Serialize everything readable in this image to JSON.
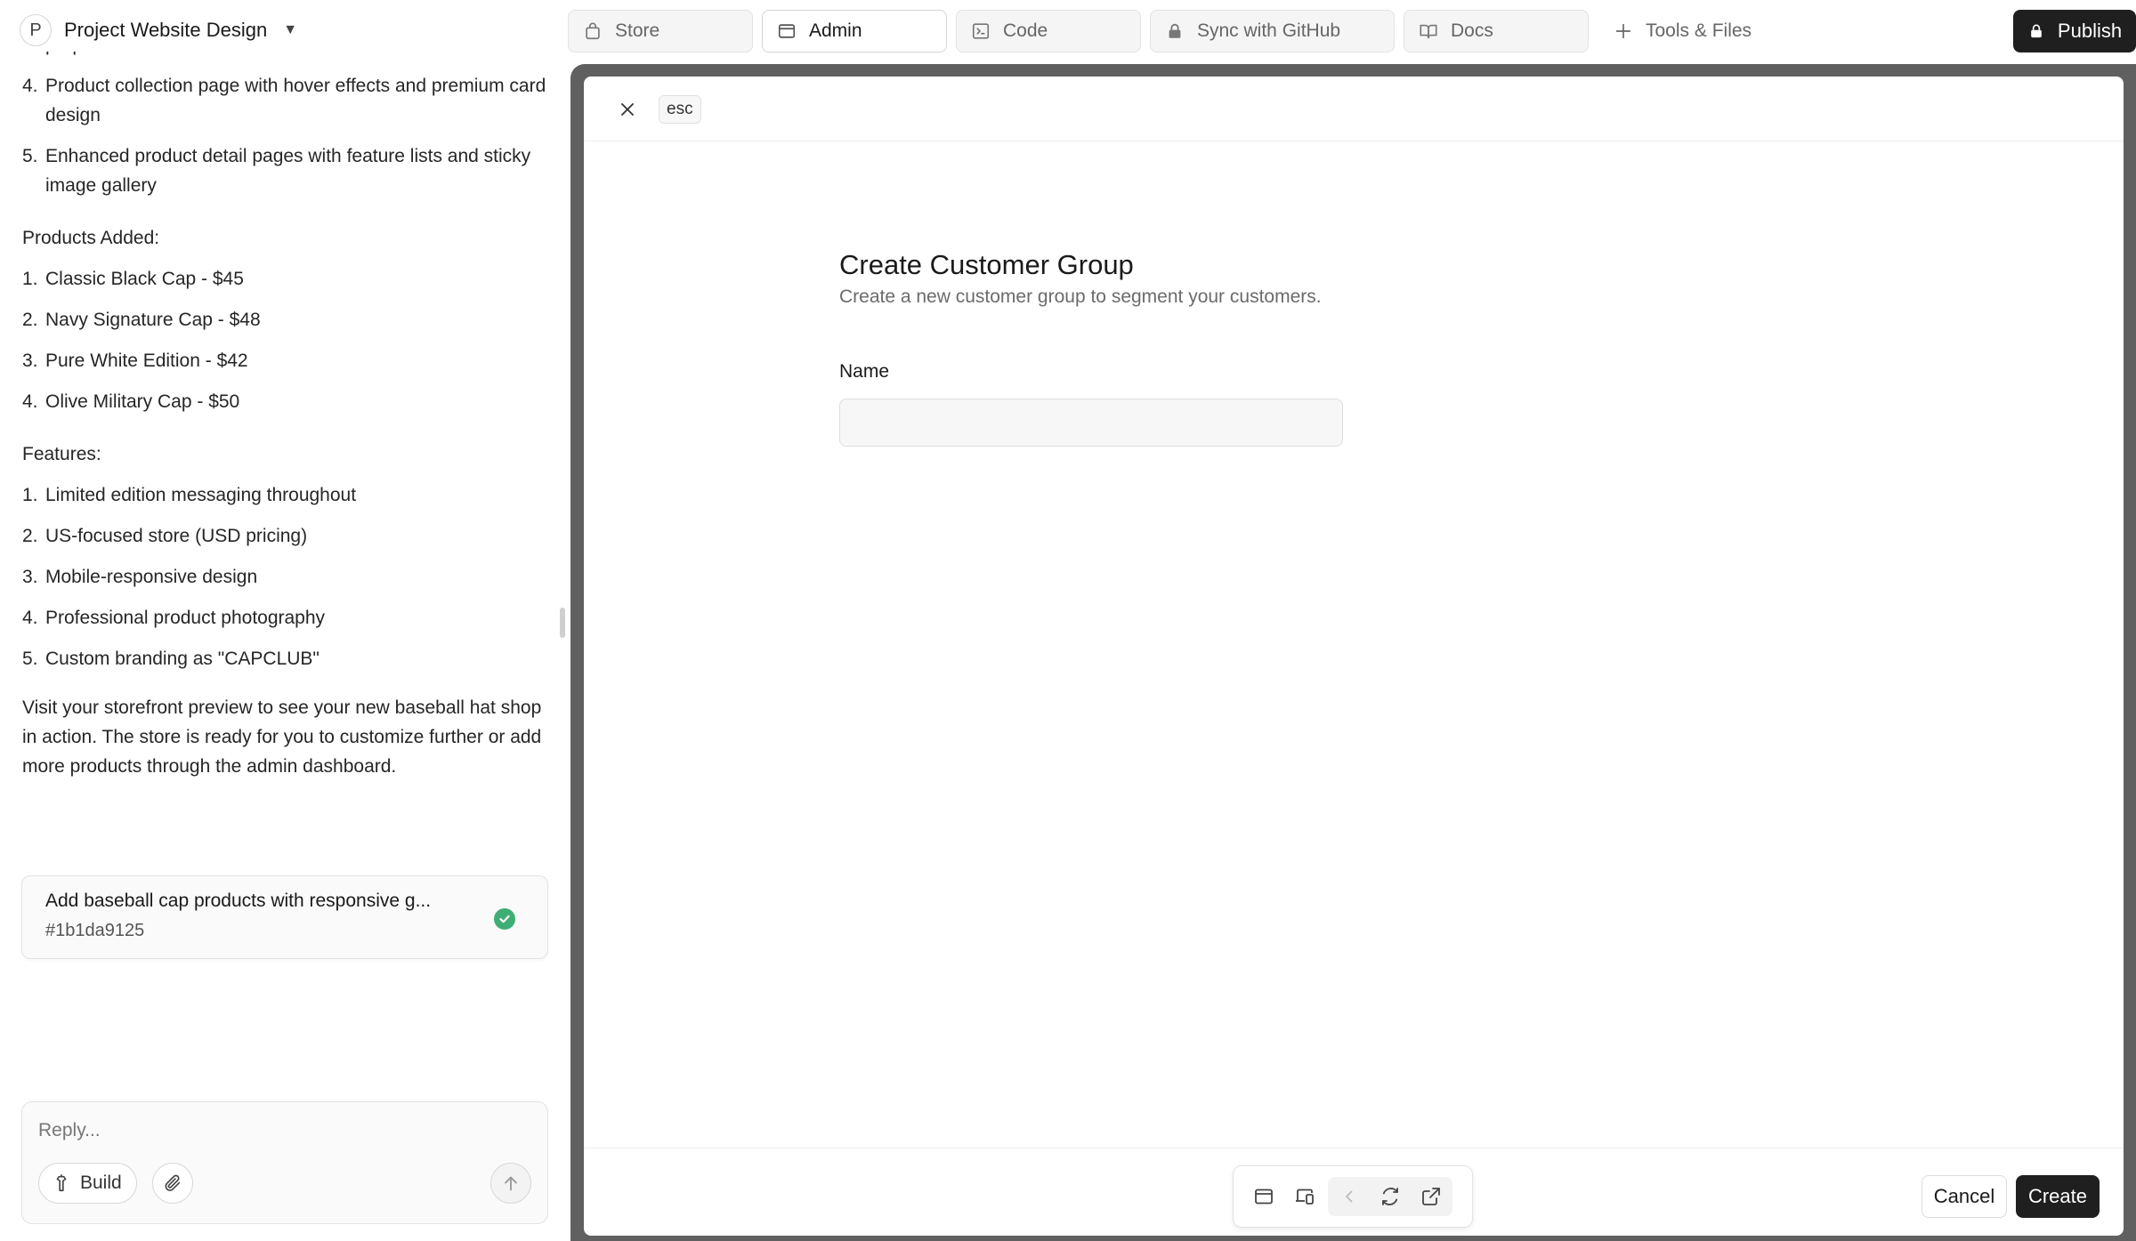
{
  "project": {
    "avatar_letter": "P",
    "name": "Project Website Design"
  },
  "chat": {
    "top_items": [
      {
        "num": "",
        "text": "propositions"
      },
      {
        "num": "4.",
        "text": "Product collection page with hover effects and premium card design"
      },
      {
        "num": "5.",
        "text": "Enhanced product detail pages with feature lists and sticky image gallery"
      }
    ],
    "products_heading": "Products Added:",
    "products": [
      {
        "num": "1.",
        "text": "Classic Black Cap - $45"
      },
      {
        "num": "2.",
        "text": "Navy Signature Cap - $48"
      },
      {
        "num": "3.",
        "text": "Pure White Edition - $42"
      },
      {
        "num": "4.",
        "text": "Olive Military Cap - $50"
      }
    ],
    "features_heading": "Features:",
    "features": [
      {
        "num": "1.",
        "text": "Limited edition messaging throughout"
      },
      {
        "num": "2.",
        "text": "US-focused store (USD pricing)"
      },
      {
        "num": "3.",
        "text": "Mobile-responsive design"
      },
      {
        "num": "4.",
        "text": "Professional product photography"
      },
      {
        "num": "5.",
        "text": "Custom branding as \"CAPCLUB\""
      }
    ],
    "closing": "Visit your storefront preview to see your new baseball hat shop in action. The store is ready for you to customize further or add more products through the admin dashboard.",
    "commit": {
      "title": "Add baseball cap products with responsive g...",
      "hash": "#1b1da9125"
    }
  },
  "reply": {
    "placeholder": "Reply...",
    "build_label": "Build"
  },
  "tabs": [
    {
      "label": "Store",
      "icon": "bag-icon"
    },
    {
      "label": "Admin",
      "icon": "window-icon",
      "active": true
    },
    {
      "label": "Code",
      "icon": "terminal-icon"
    },
    {
      "label": "Sync with GitHub",
      "icon": "lock-icon"
    },
    {
      "label": "Docs",
      "icon": "book-icon"
    },
    {
      "label": "Tools & Files",
      "icon": "plus-icon"
    }
  ],
  "publish_label": "Publish",
  "modal": {
    "esc_label": "esc",
    "title": "Create Customer Group",
    "subtitle": "Create a new customer group to segment your customers.",
    "name_label": "Name",
    "name_value": "",
    "cancel_label": "Cancel",
    "create_label": "Create"
  },
  "colors": {
    "primary_button": "#1f1f1f",
    "success": "#3fae74",
    "frame": "#606060"
  }
}
